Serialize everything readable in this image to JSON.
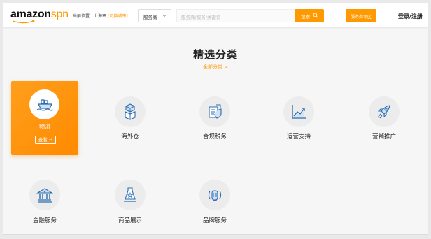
{
  "header": {
    "logo_bold": "amazon",
    "logo_light": "spn",
    "location_label": "当前位置：上海市",
    "location_switch": "[切换城市]",
    "service_select": "服务商",
    "search_placeholder": "服务商/服务/关键词",
    "search_button": "搜索",
    "service_zone_button": "服务商专区",
    "login": "登录/注册"
  },
  "main": {
    "title": "精选分类",
    "all_categories": "全部分类 >"
  },
  "categories": [
    {
      "label": "物流",
      "icon": "ship-icon",
      "active": true,
      "view_label": "查看 →"
    },
    {
      "label": "海外仓",
      "icon": "boxes-icon"
    },
    {
      "label": "合规税务",
      "icon": "tax-shield-icon"
    },
    {
      "label": "运营支持",
      "icon": "trend-chart-icon"
    },
    {
      "label": "营销推广",
      "icon": "rocket-icon"
    },
    {
      "label": "金融服务",
      "icon": "bank-icon"
    },
    {
      "label": "商品展示",
      "icon": "product-display-icon"
    },
    {
      "label": "品牌服务",
      "icon": "brand-icon"
    }
  ],
  "colors": {
    "accent": "#ff9900",
    "icon_blue": "#2b6cb0",
    "active_card": "#ff9b19"
  }
}
